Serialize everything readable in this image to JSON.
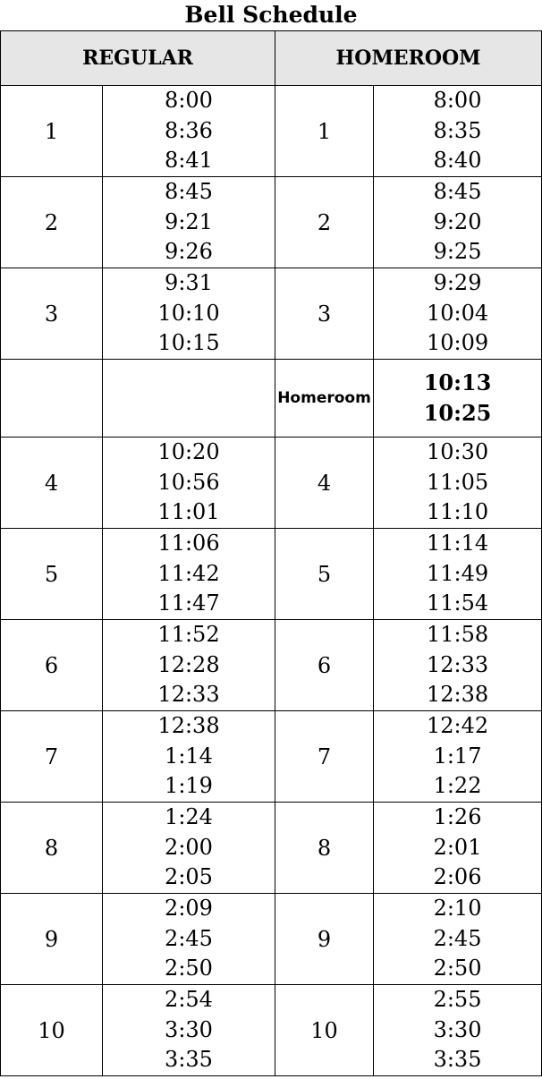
{
  "title": "Bell Schedule",
  "headers": {
    "regular": "REGULAR",
    "homeroom": "HOMEROOM"
  },
  "rows": [
    {
      "regular": {
        "period": "1",
        "times": [
          "8:00",
          "8:36",
          "8:41"
        ]
      },
      "homeroom": {
        "period": "1",
        "times": [
          "8:00",
          "8:35",
          "8:40"
        ]
      }
    },
    {
      "regular": {
        "period": "2",
        "times": [
          "8:45",
          "9:21",
          "9:26"
        ]
      },
      "homeroom": {
        "period": "2",
        "times": [
          "8:45",
          "9:20",
          "9:25"
        ]
      }
    },
    {
      "regular": {
        "period": "3",
        "times": [
          "9:31",
          "10:10",
          "10:15"
        ]
      },
      "homeroom": {
        "period": "3",
        "times": [
          "9:29",
          "10:04",
          "10:09"
        ]
      }
    },
    {
      "regular": {
        "period": "",
        "times": []
      },
      "homeroom": {
        "period": "Homeroom",
        "times": [
          "10:13",
          "10:25"
        ]
      }
    },
    {
      "regular": {
        "period": "4",
        "times": [
          "10:20",
          "10:56",
          "11:01"
        ]
      },
      "homeroom": {
        "period": "4",
        "times": [
          "10:30",
          "11:05",
          "11:10"
        ]
      }
    },
    {
      "regular": {
        "period": "5",
        "times": [
          "11:06",
          "11:42",
          "11:47"
        ]
      },
      "homeroom": {
        "period": "5",
        "times": [
          "11:14",
          "11:49",
          "11:54"
        ]
      }
    },
    {
      "regular": {
        "period": "6",
        "times": [
          "11:52",
          "12:28",
          "12:33"
        ]
      },
      "homeroom": {
        "period": "6",
        "times": [
          "11:58",
          "12:33",
          "12:38"
        ]
      }
    },
    {
      "regular": {
        "period": "7",
        "times": [
          "12:38",
          "1:14",
          "1:19"
        ]
      },
      "homeroom": {
        "period": "7",
        "times": [
          "12:42",
          "1:17",
          "1:22"
        ]
      }
    },
    {
      "regular": {
        "period": "8",
        "times": [
          "1:24",
          "2:00",
          "2:05"
        ]
      },
      "homeroom": {
        "period": "8",
        "times": [
          "1:26",
          "2:01",
          "2:06"
        ]
      }
    },
    {
      "regular": {
        "period": "9",
        "times": [
          "2:09",
          "2:45",
          "2:50"
        ]
      },
      "homeroom": {
        "period": "9",
        "times": [
          "2:10",
          "2:45",
          "2:50"
        ]
      }
    },
    {
      "regular": {
        "period": "10",
        "times": [
          "2:54",
          "3:30",
          "3:35"
        ]
      },
      "homeroom": {
        "period": "10",
        "times": [
          "2:55",
          "3:30",
          "3:35"
        ]
      }
    }
  ]
}
